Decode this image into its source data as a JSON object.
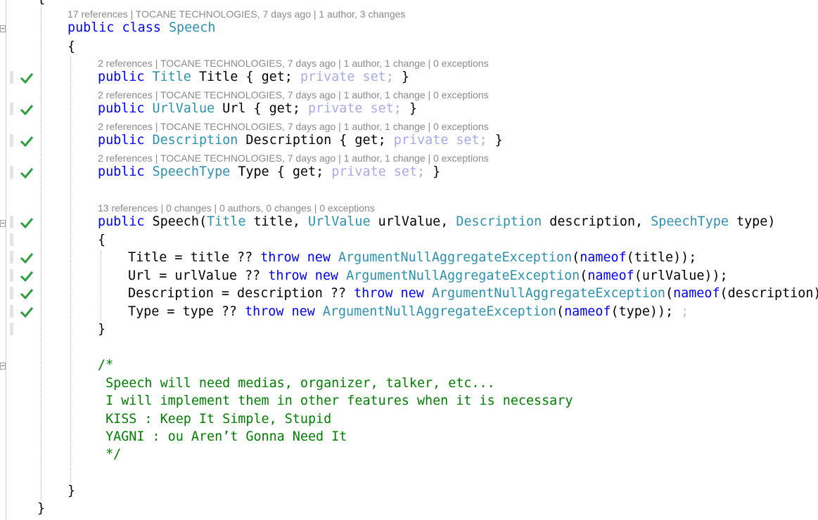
{
  "code": {
    "top_fragment": "{",
    "class_lens": "17 references | TOCANE TECHNOLOGIES, 7 days ago | 1 author, 3 changes",
    "class_keywords": "public class",
    "class_name": "Speech",
    "open_brace": "{",
    "close_brace": "}",
    "prop_lens": "2 references | TOCANE TECHNOLOGIES, 7 days ago | 1 author, 1 change | 0 exceptions",
    "ctor_lens": "13 references | 0 changes | 0 authors, 0 changes | 0 exceptions",
    "public_kw": "public",
    "get_text": "{ get;",
    "private_set": "private set;",
    "close_prop": "}",
    "properties": [
      {
        "type": "Title",
        "name": "Title"
      },
      {
        "type": "UrlValue",
        "name": "Url"
      },
      {
        "type": "Description",
        "name": "Description"
      },
      {
        "type": "SpeechType",
        "name": "Type"
      }
    ],
    "ctor": {
      "name": "Speech(",
      "params": [
        {
          "type": "Title",
          "name": "title,"
        },
        {
          "type": "UrlValue",
          "name": "urlValue,"
        },
        {
          "type": "Description",
          "name": "description,"
        },
        {
          "type": "SpeechType",
          "name": "type)"
        }
      ]
    },
    "throw_kw": "throw",
    "new_kw": "new",
    "exception_type": "ArgumentNullAggregateException",
    "nameof_kw": "nameof",
    "stray_semicolon": ";",
    "assignments": [
      {
        "lhs": "Title = title ?? ",
        "arg": "(title));"
      },
      {
        "lhs": "Url = urlValue ?? ",
        "arg": "(urlValue));"
      },
      {
        "lhs": "Description = description ?? ",
        "arg": "(description));"
      },
      {
        "lhs": "Type = type ?? ",
        "arg": "(type));"
      }
    ],
    "comment_lines": [
      "/*",
      " Speech will need medias, organizer, talker, etc...",
      " I will implement them in other features when it is necessary",
      " KISS : Keep It Simple, Stupid",
      " YAGNI : ou Aren’t Gonna Need It",
      " */"
    ]
  },
  "colors": {
    "keyword": "#0000ff",
    "type": "#2b91af",
    "comment": "#008000",
    "codelens": "#8a8a8a",
    "check": "#2e9e3e"
  },
  "icons": [
    "fold-icon",
    "check-icon"
  ]
}
